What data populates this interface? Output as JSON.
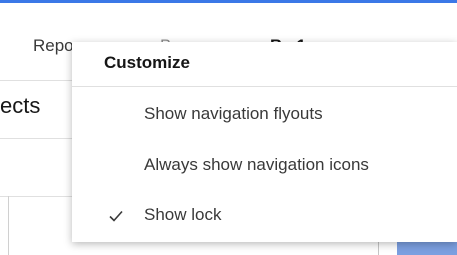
{
  "breadcrumb": {
    "first": "Repo",
    "second_partial": "Ba",
    "third_partial": "B...1"
  },
  "panel": {
    "title_partial": "ects"
  },
  "menu": {
    "header": "Customize",
    "items": [
      {
        "label": "Show navigation flyouts",
        "checked": false
      },
      {
        "label": "Always show navigation icons",
        "checked": false
      },
      {
        "label": "Show lock",
        "checked": true
      }
    ]
  },
  "colors": {
    "accent": "#3b78e7",
    "panel_highlight": "#7b9fe0"
  },
  "icons": {
    "check": "checkmark-icon"
  }
}
